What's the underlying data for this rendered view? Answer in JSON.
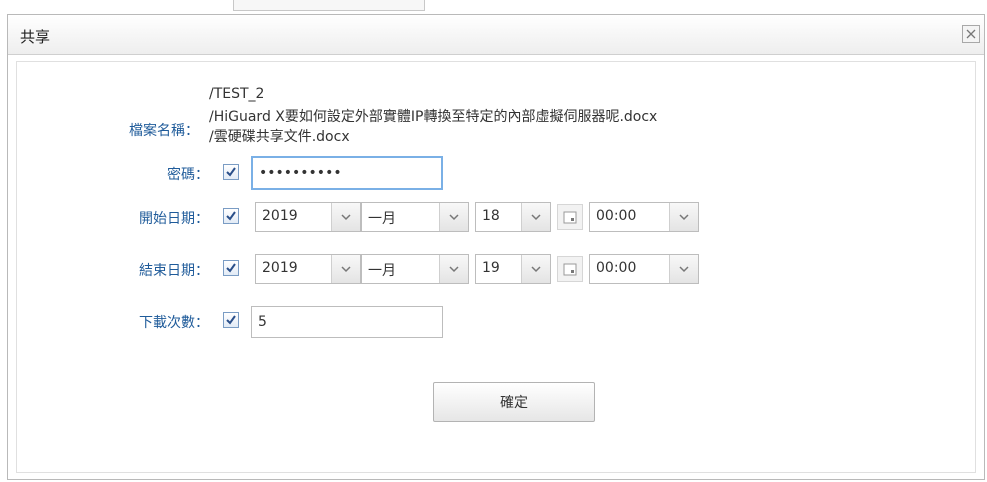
{
  "dialog": {
    "title": "共享",
    "close_icon": "close-icon"
  },
  "form": {
    "filename": {
      "label": "檔案名稱：",
      "files": [
        "/TEST_2",
        "/HiGuard X要如何設定外部實體IP轉換至特定的內部虛擬伺服器呢.docx",
        "/雲硬碟共享文件.docx"
      ]
    },
    "password": {
      "label": "密碼：",
      "checked": true,
      "value": "••••••••••"
    },
    "start_date": {
      "label": "開始日期：",
      "checked": true,
      "year": "2019",
      "month": "一月",
      "day": "18",
      "time": "00:00"
    },
    "end_date": {
      "label": "結束日期：",
      "checked": true,
      "year": "2019",
      "month": "一月",
      "day": "19",
      "time": "00:00"
    },
    "download_count": {
      "label": "下載次數：",
      "checked": true,
      "value": "5"
    }
  },
  "buttons": {
    "confirm_label": "確定"
  }
}
